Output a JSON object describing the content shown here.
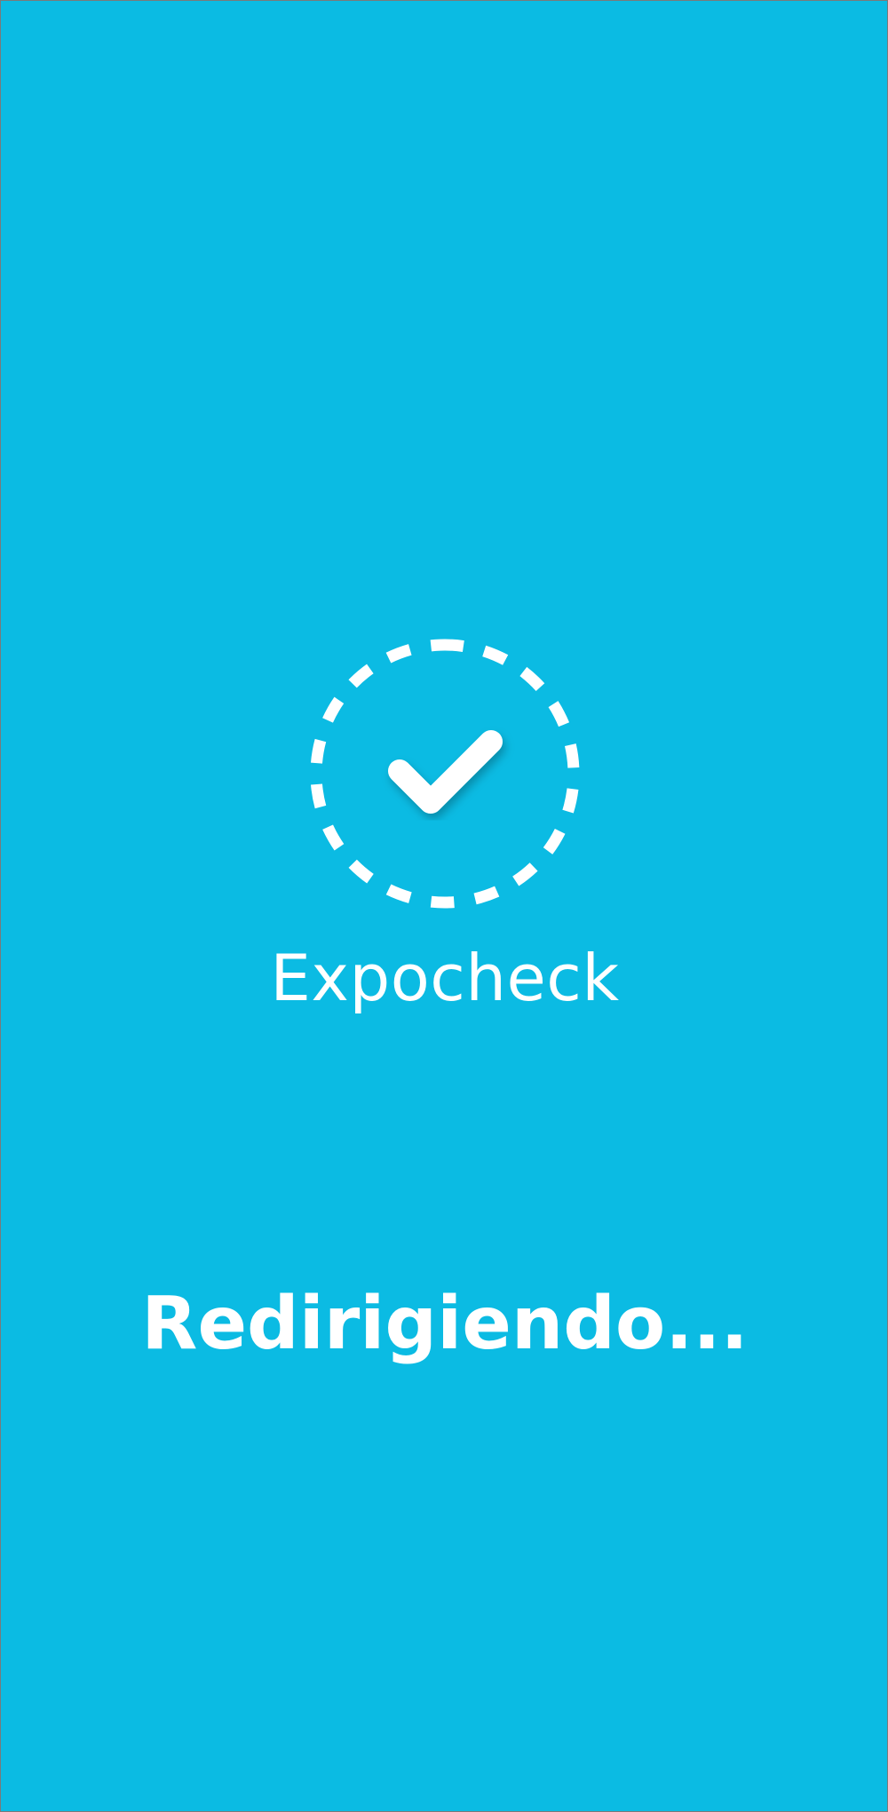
{
  "theme": {
    "background": "#0bbbe3",
    "foreground": "#ffffff"
  },
  "logo": {
    "icon": "check-circle-dashed-icon"
  },
  "app": {
    "name": "Expocheck"
  },
  "status": {
    "message": "Redirigiendo..."
  }
}
